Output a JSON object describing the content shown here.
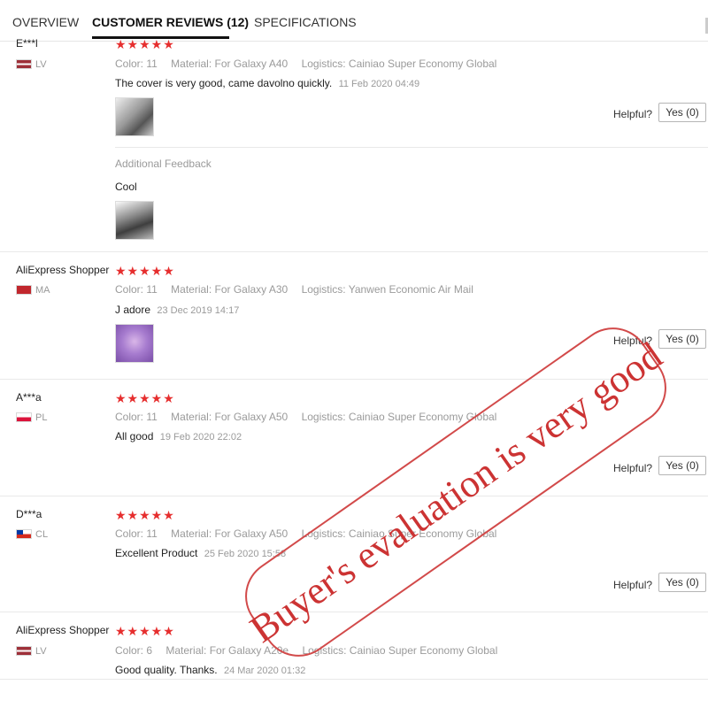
{
  "tabs": [
    {
      "label": "OVERVIEW",
      "active": false
    },
    {
      "label": "CUSTOMER REVIEWS (12)",
      "active": true
    },
    {
      "label": "SPECIFICATIONS",
      "active": false
    }
  ],
  "colors": {
    "star": "#e62e2e",
    "stamp": "#cc3333"
  },
  "reviews": [
    {
      "name": "E***l",
      "country": "LV",
      "stars": "★★★★★",
      "rating": 5,
      "color": "Color: 11",
      "material": "Material: For Galaxy A40",
      "logistics": "Logistics: Cainiao Super Economy Global",
      "text": "The cover is very good, came davolno quickly.",
      "date": "11 Feb 2020 04:49",
      "helpful": "Helpful?",
      "yes": "Yes (0)",
      "additional_label": "Additional Feedback",
      "additional_text": "Cool"
    },
    {
      "name": "AliExpress Shopper",
      "country": "MA",
      "stars": "★★★★★",
      "rating": 5,
      "color": "Color: 11",
      "material": "Material: For Galaxy A30",
      "logistics": "Logistics: Yanwen Economic Air Mail",
      "text": "J adore",
      "date": "23 Dec 2019 14:17",
      "helpful": "Helpful?",
      "yes": "Yes (0)"
    },
    {
      "name": "A***a",
      "country": "PL",
      "stars": "★★★★★",
      "rating": 5,
      "color": "Color: 11",
      "material": "Material: For Galaxy A50",
      "logistics": "Logistics: Cainiao Super Economy Global",
      "text": "All good",
      "date": "19 Feb 2020 22:02",
      "helpful": "Helpful?",
      "yes": "Yes (0)"
    },
    {
      "name": "D***a",
      "country": "CL",
      "stars": "★★★★★",
      "rating": 5,
      "color": "Color: 11",
      "material": "Material: For Galaxy A50",
      "logistics": "Logistics: Cainiao Super Economy Global",
      "text": "Excellent Product",
      "date": "25 Feb 2020 15:58",
      "helpful": "Helpful?",
      "yes": "Yes (0)"
    },
    {
      "name": "AliExpress Shopper",
      "country": "LV",
      "stars": "★★★★★",
      "rating": 5,
      "color": "Color: 6",
      "material": "Material: For Galaxy A20e",
      "logistics": "Logistics: Cainiao Super Economy Global",
      "text": "Good quality. Thanks.",
      "date": "24 Mar 2020 01:32"
    }
  ],
  "stamp": {
    "text": "Buyer's evaluation is very good"
  }
}
